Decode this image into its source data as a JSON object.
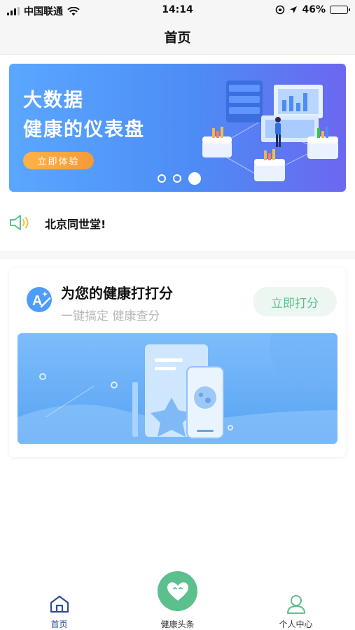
{
  "status_bar": {
    "carrier": "中国联通",
    "time": "14:14",
    "battery": "46%",
    "battery_level": 0.46
  },
  "nav": {
    "title": "首页"
  },
  "banner": {
    "title_line1": "大数据",
    "title_line2": "健康的仪表盘",
    "button_label": "立即体验",
    "active_slide": 3,
    "slide_count": 3
  },
  "notice": {
    "text": "北京同世堂!"
  },
  "score_card": {
    "title": "为您的健康打打分",
    "subtitle": "一键搞定 健康查分",
    "button_label": "立即打分"
  },
  "tabbar": {
    "items": [
      {
        "label": "首页",
        "icon": "home-icon",
        "active": true
      },
      {
        "label": "健康头条",
        "icon": "heart-icon",
        "active": false
      },
      {
        "label": "个人中心",
        "icon": "person-icon",
        "active": false
      }
    ]
  },
  "colors": {
    "accent_green": "#5bc08d",
    "banner_blue": "#4d8cf5",
    "orange_button": "#f59a37",
    "tab_active": "#2d4e8f"
  }
}
